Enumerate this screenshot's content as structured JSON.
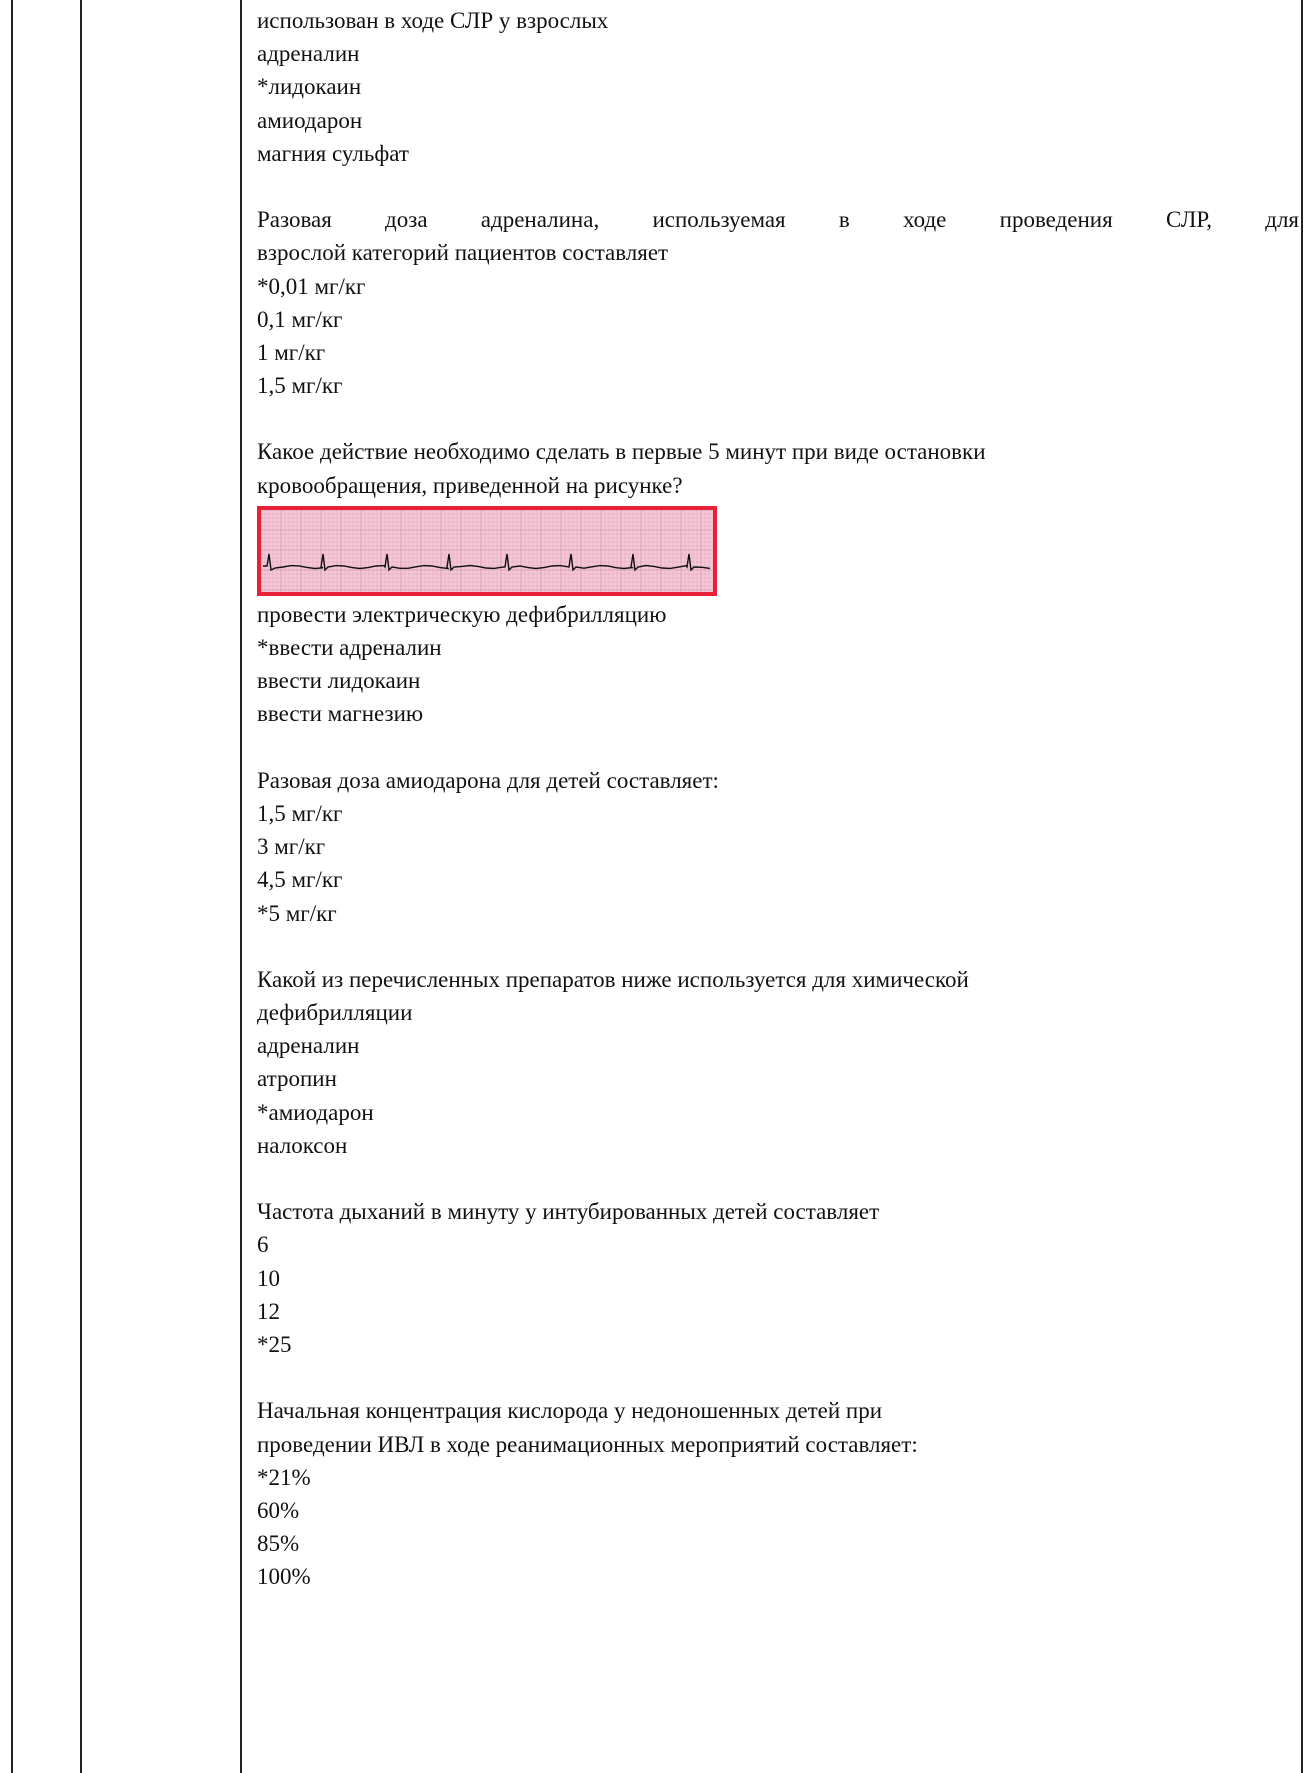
{
  "questions": [
    {
      "stem_lines": [
        "использован в ходе СЛР у взрослых"
      ],
      "options": [
        "адреналин",
        "*лидокаин",
        "амиодарон",
        "магния сульфат"
      ]
    },
    {
      "stem_lines": [
        "Разовая доза адреналина, используемая в ходе проведения СЛР, для",
        "взрослой категорий пациентов составляет"
      ],
      "options": [
        "*0,01 мг/кг",
        "0,1 мг/кг",
        "1 мг/кг",
        "1,5 мг/кг"
      ]
    },
    {
      "stem_lines": [
        "Какое действие необходимо сделать в первые 5 минут при виде остановки",
        "кровообращения, приведенной на рисунке?"
      ],
      "options": [
        "провести электрическую дефибрилляцию",
        "*ввести адреналин",
        "ввести лидокаин",
        "ввести магнезию"
      ]
    },
    {
      "stem_lines": [
        "Разовая доза амиодарона для детей составляет:"
      ],
      "options": [
        "1,5 мг/кг",
        "3 мг/кг",
        "4,5 мг/кг",
        "*5 мг/кг"
      ]
    },
    {
      "stem_lines": [
        "Какой из перечисленных препаратов ниже используется для химической",
        "дефибрилляции"
      ],
      "options": [
        "адреналин",
        "атропин",
        "*амиодарон",
        "налоксон"
      ]
    },
    {
      "stem_lines": [
        "Частота дыханий в минуту у интубированных детей составляет"
      ],
      "options": [
        "6",
        "10",
        "12",
        "*25"
      ]
    },
    {
      "stem_lines": [
        "Начальная концентрация кислорода у недоношенных детей при",
        "проведении ИВЛ в ходе реанимационных мероприятий составляет:"
      ],
      "options": [
        "*21%",
        "60%",
        "85%",
        "100%"
      ]
    }
  ],
  "colors": {
    "ecg_border": "#e8203a",
    "ecg_background": "#f6c8d6",
    "ecg_grid": "#d9a0b8",
    "ecg_trace": "#111111"
  }
}
